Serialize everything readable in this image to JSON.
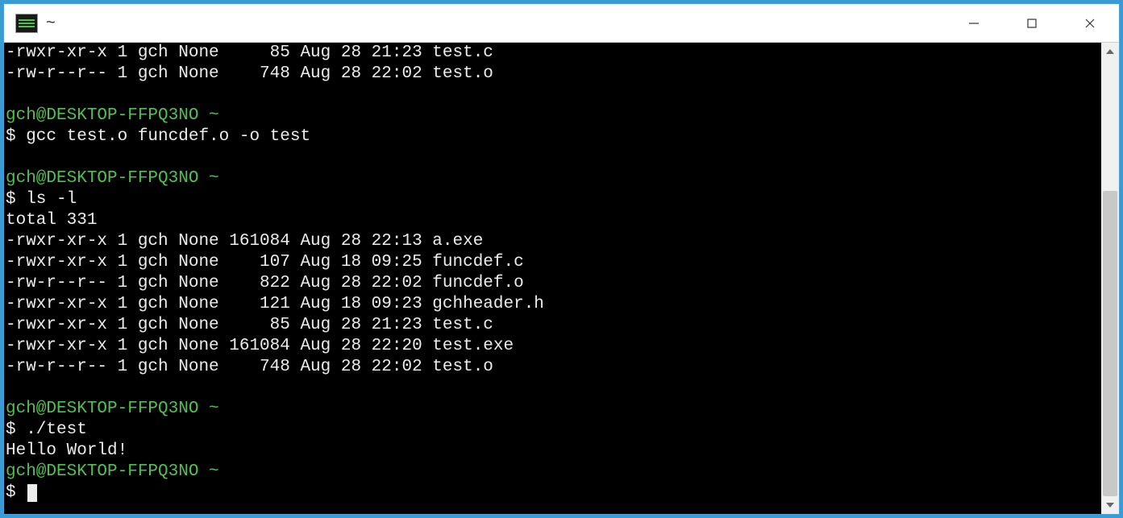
{
  "titlebar": {
    "title": "~"
  },
  "terminal": {
    "lines": [
      {
        "type": "out",
        "text": "-rwxr-xr-x 1 gch None     85 Aug 28 21:23 test.c"
      },
      {
        "type": "out",
        "text": "-rw-r--r-- 1 gch None    748 Aug 28 22:02 test.o"
      },
      {
        "type": "blank",
        "text": ""
      },
      {
        "type": "prompt",
        "text": "gch@DESKTOP-FFPQ3NO ~"
      },
      {
        "type": "cmd",
        "text": "$ gcc test.o funcdef.o -o test"
      },
      {
        "type": "blank",
        "text": ""
      },
      {
        "type": "prompt",
        "text": "gch@DESKTOP-FFPQ3NO ~"
      },
      {
        "type": "cmd",
        "text": "$ ls -l"
      },
      {
        "type": "out",
        "text": "total 331"
      },
      {
        "type": "out",
        "text": "-rwxr-xr-x 1 gch None 161084 Aug 28 22:13 a.exe"
      },
      {
        "type": "out",
        "text": "-rwxr-xr-x 1 gch None    107 Aug 18 09:25 funcdef.c"
      },
      {
        "type": "out",
        "text": "-rw-r--r-- 1 gch None    822 Aug 28 22:02 funcdef.o"
      },
      {
        "type": "out",
        "text": "-rwxr-xr-x 1 gch None    121 Aug 18 09:23 gchheader.h"
      },
      {
        "type": "out",
        "text": "-rwxr-xr-x 1 gch None     85 Aug 28 21:23 test.c"
      },
      {
        "type": "out",
        "text": "-rwxr-xr-x 1 gch None 161084 Aug 28 22:20 test.exe"
      },
      {
        "type": "out",
        "text": "-rw-r--r-- 1 gch None    748 Aug 28 22:02 test.o"
      },
      {
        "type": "blank",
        "text": ""
      },
      {
        "type": "prompt",
        "text": "gch@DESKTOP-FFPQ3NO ~"
      },
      {
        "type": "cmd",
        "text": "$ ./test"
      },
      {
        "type": "out",
        "text": "Hello World!"
      },
      {
        "type": "prompt",
        "text": "gch@DESKTOP-FFPQ3NO ~"
      },
      {
        "type": "cmdcur",
        "text": "$ "
      }
    ]
  }
}
